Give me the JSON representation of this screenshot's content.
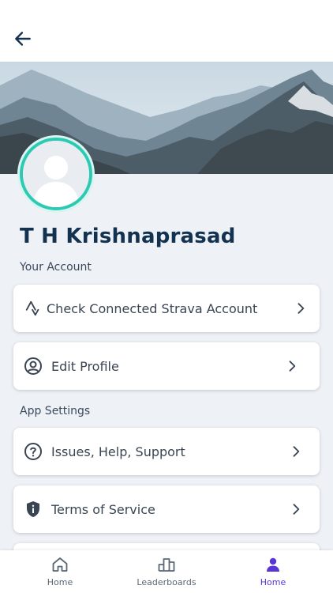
{
  "header": {
    "back_icon": "arrow-left-icon"
  },
  "profile": {
    "name": "T H Krishnaprasad",
    "avatar_icon": "user-silhouette-icon"
  },
  "sections": {
    "account": "Your Account",
    "app_settings": "App Settings"
  },
  "items": [
    {
      "label": "Check Connected Strava Account",
      "icon": "strava-icon"
    },
    {
      "label": "Edit Profile",
      "icon": "user-circle-icon"
    },
    {
      "label": "Issues, Help, Support",
      "icon": "help-circle-icon"
    },
    {
      "label": "Terms of Service",
      "icon": "shield-info-icon"
    }
  ],
  "nav": [
    {
      "label": "Home",
      "icon": "home-icon",
      "active": false
    },
    {
      "label": "Leaderboards",
      "icon": "podium-icon",
      "active": false
    },
    {
      "label": "Home",
      "icon": "person-icon",
      "active": true
    }
  ],
  "colors": {
    "accent": "#5a35d6",
    "avatar_ring": "#2cc9b3",
    "name": "#13324f"
  }
}
